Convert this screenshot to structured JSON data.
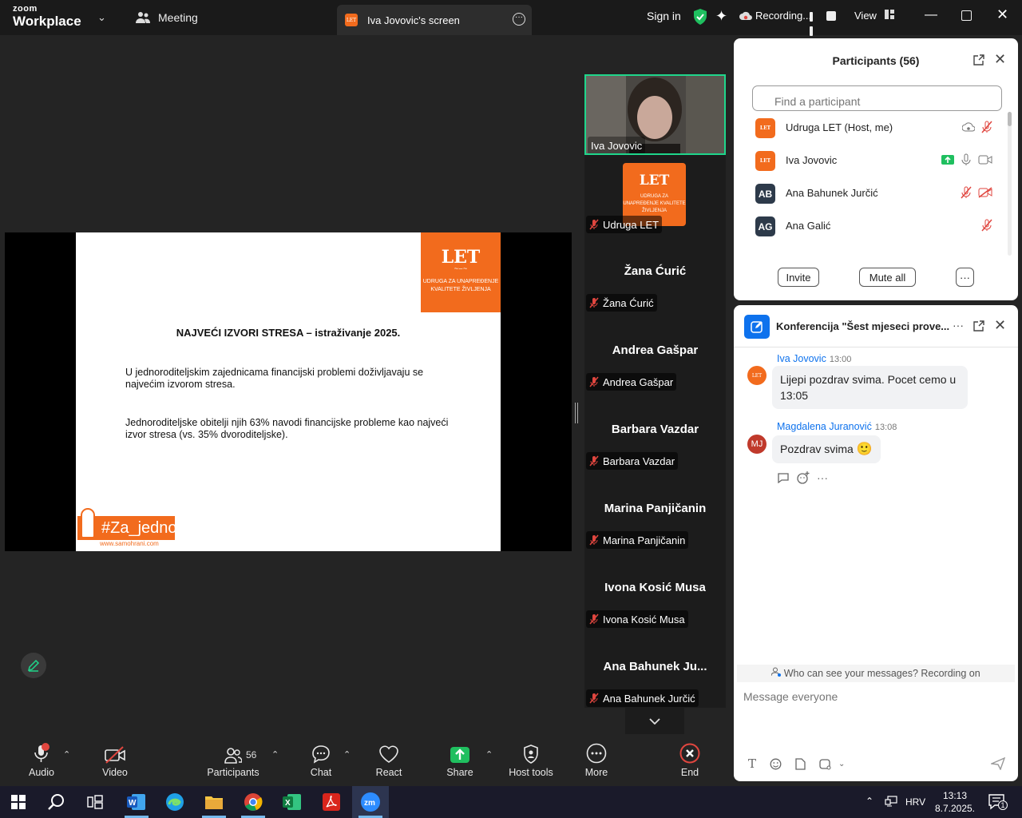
{
  "topbar": {
    "logo_top": "zoom",
    "logo_bottom": "Workplace",
    "meeting_label": "Meeting",
    "screen_tab": "Iva Jovovic's screen",
    "signin": "Sign in",
    "recording": "Recording...",
    "view": "View"
  },
  "slide": {
    "logo": "LET",
    "logo_sub": "UDRUGA ZA UNAPREĐENJE KVALITETE ŽIVLJENJA",
    "title": "NAJVEĆI IZVORI STRESA – istraživanje 2025.",
    "p1": "U jednoroditeljskim zajednicama financijski problemi doživljavaju se najvećim izvorom stresa.",
    "p2": "Jednoroditeljske obitelji njih 63% navodi financijske probleme kao najveći izvor stresa (vs. 35% dvoroditeljske).",
    "footer_tag": "#Za_jedno",
    "footer_url": "www.samohrani.com"
  },
  "gallery": {
    "video_name": "Iva Jovovic",
    "udruga_label": "Udruga LET",
    "udruga_logo": "LET",
    "udruga_logo_sub": "UDRUGA ZA UNAPREĐENJE KVALITETE ŽIVLJENJA",
    "tiles": [
      {
        "big": "Žana Ćurić",
        "label": "Žana Ćurić"
      },
      {
        "big": "Andrea Gašpar",
        "label": "Andrea Gašpar"
      },
      {
        "big": "Barbara Vazdar",
        "label": "Barbara Vazdar"
      },
      {
        "big": "Marina Panjičanin",
        "label": "Marina Panjičanin"
      },
      {
        "big": "Ivona Kosić Musa",
        "label": "Ivona Kosić Musa"
      },
      {
        "big": "Ana Bahunek Ju...",
        "label": "Ana Bahunek Jurčić"
      }
    ]
  },
  "participants": {
    "title": "Participants (56)",
    "search_placeholder": "Find a participant",
    "list": [
      {
        "avatar": "LET",
        "name": "Udruga LET (Host, me)"
      },
      {
        "avatar": "LET",
        "name": "Iva Jovovic"
      },
      {
        "avatar": "AB",
        "name": "Ana Bahunek Jurčić"
      },
      {
        "avatar": "AG",
        "name": "Ana Galić"
      }
    ],
    "invite": "Invite",
    "mute_all": "Mute all",
    "more": "···"
  },
  "chat": {
    "title": "Konferencija \"Šest mjeseci prove...",
    "messages": [
      {
        "avatar": "LET",
        "sender": "Iva Jovovic",
        "time": "13:00",
        "text": "Lijepi pozdrav svima. Pocet cemo u 13:05"
      },
      {
        "avatar": "MJ",
        "sender": "Magdalena Juranović",
        "time": "13:08",
        "text": "Pozdrav svima"
      }
    ],
    "emoji": "🙂",
    "who_can_see": "Who can see your messages? Recording on",
    "input_placeholder": "Message everyone"
  },
  "toolbar": {
    "audio": "Audio",
    "video": "Video",
    "participants": "Participants",
    "participants_count": "56",
    "chat": "Chat",
    "react": "React",
    "share": "Share",
    "host_tools": "Host tools",
    "more": "More",
    "end": "End"
  },
  "taskbar": {
    "lang": "HRV",
    "time": "13:13",
    "date": "8.7.2025.",
    "notif_count": "1"
  },
  "colors": {
    "accent": "#0e72ed",
    "let_orange": "#f26b1d",
    "active_speaker": "#1fd68b",
    "mute_red": "#e0463f"
  }
}
